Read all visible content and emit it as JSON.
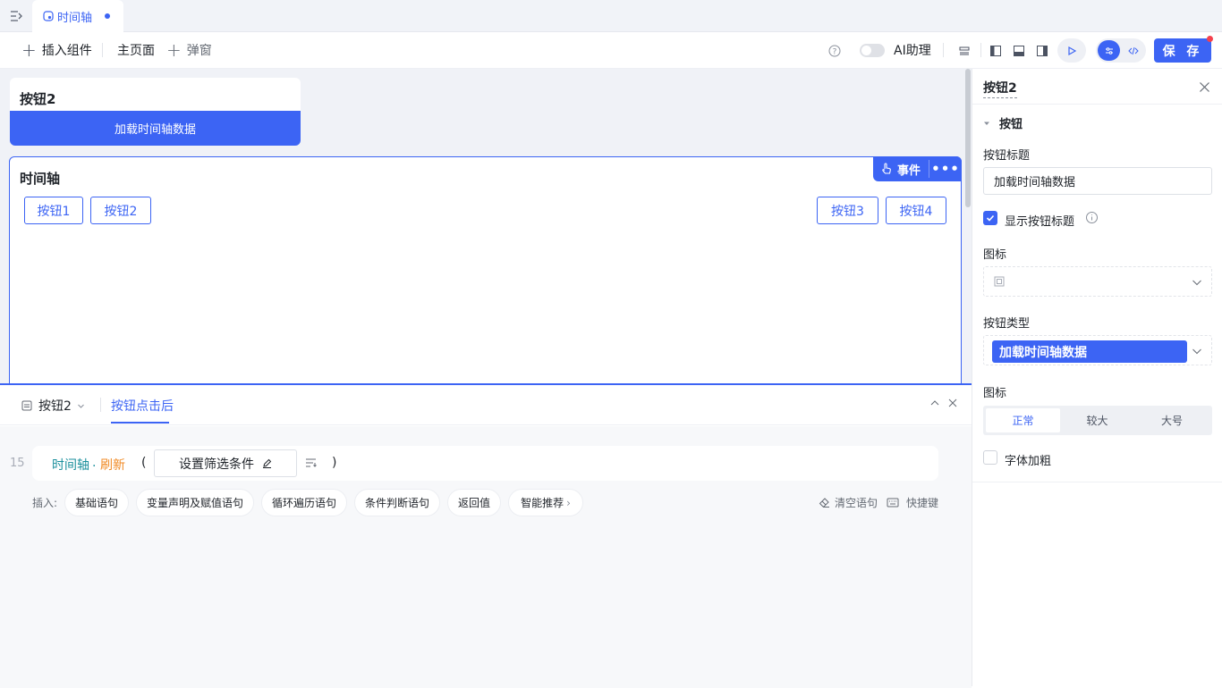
{
  "tabs": [
    {
      "label": "时间轴",
      "modified": true
    }
  ],
  "toolbar": {
    "insert_component": "插入组件",
    "main_page": "主页面",
    "popup": "弹窗",
    "ai_assistant": "AI助理",
    "save": "保 存"
  },
  "canvas": {
    "card1": {
      "title": "按钮2",
      "button": "加载时间轴数据"
    },
    "card2": {
      "title": "时间轴",
      "event_label": "事件",
      "buttons": [
        "按钮1",
        "按钮2",
        "按钮3",
        "按钮4"
      ]
    }
  },
  "bottom": {
    "component_select": "按钮2",
    "tab_active": "按钮点击后",
    "line_number": "15",
    "stmt_object": "时间轴",
    "stmt_dot": ".",
    "stmt_method": "刷新",
    "paren_open": "(",
    "paren_close": ")",
    "param": "设置筛选条件",
    "insert_label": "插入:",
    "pills": [
      "基础语句",
      "变量声明及赋值语句",
      "循环遍历语句",
      "条件判断语句",
      "返回值",
      "智能推荐"
    ],
    "clear": "清空语句",
    "shortcut": "快捷键"
  },
  "right": {
    "title": "按钮2",
    "section": "按钮",
    "btn_title_label": "按钮标题",
    "btn_title_value": "加载时间轴数据",
    "show_title_label": "显示按钮标题",
    "show_title_checked": true,
    "icon_label": "图标",
    "btn_type_label": "按钮类型",
    "btn_type_value": "加载时间轴数据",
    "icon_size_label": "图标",
    "sizes": [
      "正常",
      "较大",
      "大号"
    ],
    "size_selected": "正常",
    "bold_label": "字体加粗",
    "bold_checked": false
  },
  "colors": {
    "primary": "#3c64f4",
    "method": "#f08a24",
    "object": "#1a8f9c"
  }
}
